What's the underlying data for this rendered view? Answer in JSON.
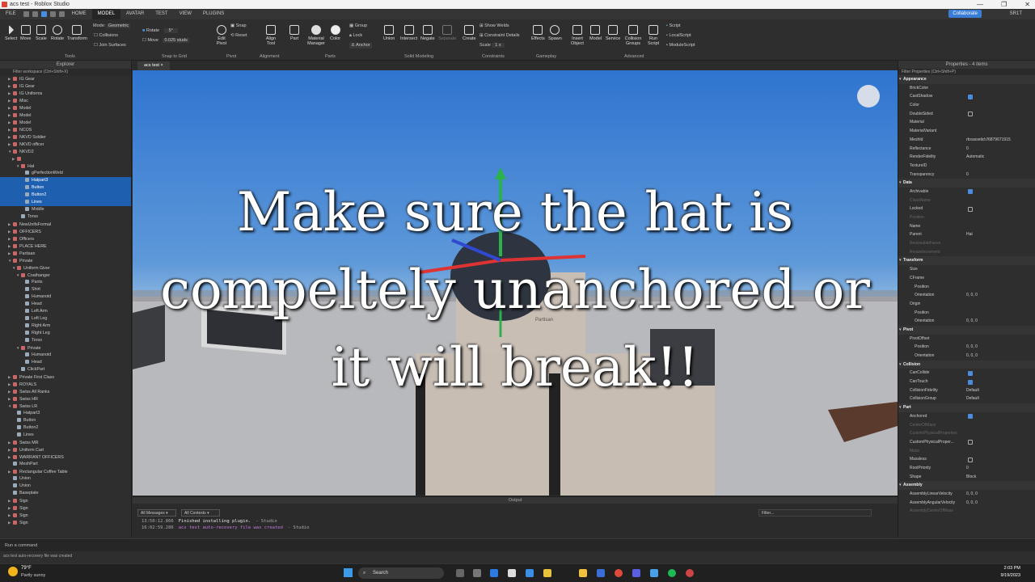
{
  "window": {
    "title": "acs test - Roblox Studio",
    "controls": [
      "—",
      "❐",
      "✕"
    ]
  },
  "menubar": {
    "file": "FILE",
    "tabs": [
      "HOME",
      "MODEL",
      "AVATAR",
      "TEST",
      "VIEW",
      "PLUGINS"
    ],
    "collaborate": "Collaborate",
    "user": "SR1T"
  },
  "ribbon": {
    "tools": [
      "Select",
      "Move",
      "Scale",
      "Rotate",
      "Transform"
    ],
    "mode_label": "Mode:",
    "mode_value": "Geometric",
    "collisions": "Collisions",
    "join_surfaces": "Join Surfaces",
    "rotate_label": "Rotate",
    "rotate_value": "5°",
    "move_label": "Move",
    "move_value": "0.025 studs",
    "edit_pivot": "Edit Pivot",
    "snap": "Snap",
    "reset": "Reset",
    "align_tool": "Align Tool",
    "part": "Part",
    "material_manager": "Material Manager",
    "color": "Color",
    "group": "Group",
    "lock": "Lock",
    "anchor": "Anchor",
    "union": "Union",
    "intersect": "Intersect",
    "negate": "Negate",
    "separate": "Separate",
    "create": "Create",
    "show_welds": "Show Welds",
    "constraint_details": "Constraint Details",
    "scale_label": "Scale",
    "scale_value": "1 x",
    "effects": "Effects",
    "spawn": "Spawn",
    "insert_object": "Insert Object",
    "model": "Model",
    "service": "Service",
    "collision_groups": "Collision Groups",
    "run_script": "Run Script",
    "script": "Script",
    "localscript": "LocalScript",
    "modulescript": "ModuleScript",
    "groups": [
      "Tools",
      "Snap to Grid",
      "Pivot",
      "Alignment",
      "Parts",
      "Solid Modeling",
      "Constraints",
      "Gameplay",
      "Advanced"
    ]
  },
  "explorer": {
    "title": "Explorer",
    "filter": "Filter workspace (Ctrl+Shift+X)",
    "rows": [
      {
        "t": "IG Gear",
        "d": 2
      },
      {
        "t": "IG Gear",
        "d": 2
      },
      {
        "t": "IG Uniforms",
        "d": 2
      },
      {
        "t": "Misc",
        "d": 2
      },
      {
        "t": "Model",
        "d": 2
      },
      {
        "t": "Model",
        "d": 2
      },
      {
        "t": "Model",
        "d": 2
      },
      {
        "t": "NCOS",
        "d": 2
      },
      {
        "t": "NKVD Soldier",
        "d": 2
      },
      {
        "t": "NKVD officer",
        "d": 2
      },
      {
        "t": "NKVD2",
        "d": 2,
        "o": true
      },
      {
        "t": "",
        "d": 3
      },
      {
        "t": "Hat",
        "d": 4,
        "o": true
      },
      {
        "t": "gPerfectionWeld",
        "d": 5,
        "p": true
      },
      {
        "t": "Hatpart3",
        "d": 5,
        "p": true,
        "s": true
      },
      {
        "t": "Button",
        "d": 5,
        "p": true,
        "s": true
      },
      {
        "t": "Button2",
        "d": 5,
        "p": true,
        "s": true
      },
      {
        "t": "Lines",
        "d": 5,
        "p": true,
        "s": true
      },
      {
        "t": "Middle",
        "d": 5,
        "p": true
      },
      {
        "t": "Torso",
        "d": 4,
        "p": true
      },
      {
        "t": "NewUnifsFormal",
        "d": 2
      },
      {
        "t": "OFFICERS",
        "d": 2
      },
      {
        "t": "Officers",
        "d": 2
      },
      {
        "t": "PLACE HERE",
        "d": 2
      },
      {
        "t": "Partisan",
        "d": 2
      },
      {
        "t": "Private",
        "d": 2,
        "o": true
      },
      {
        "t": "Uniform Giver",
        "d": 3,
        "o": true
      },
      {
        "t": "Coathanger",
        "d": 4,
        "o": true
      },
      {
        "t": "Pants",
        "d": 5,
        "p": true
      },
      {
        "t": "Shirt",
        "d": 5,
        "p": true
      },
      {
        "t": "Humanoid",
        "d": 5,
        "p": true
      },
      {
        "t": "Head",
        "d": 5,
        "p": true
      },
      {
        "t": "Left Arm",
        "d": 5,
        "p": true
      },
      {
        "t": "Left Leg",
        "d": 5,
        "p": true
      },
      {
        "t": "Right Arm",
        "d": 5,
        "p": true
      },
      {
        "t": "Right Leg",
        "d": 5,
        "p": true
      },
      {
        "t": "Torso",
        "d": 5,
        "p": true
      },
      {
        "t": "Private",
        "d": 4,
        "o": true
      },
      {
        "t": "Humanoid",
        "d": 5,
        "p": true
      },
      {
        "t": "Head",
        "d": 5,
        "p": true
      },
      {
        "t": "ClickPart",
        "d": 4,
        "p": true
      },
      {
        "t": "Private First Class",
        "d": 2
      },
      {
        "t": "ROYALS",
        "d": 2
      },
      {
        "t": "Swiss All Ranks",
        "d": 2
      },
      {
        "t": "Swiss HR",
        "d": 2
      },
      {
        "t": "Swiss LR",
        "d": 2,
        "o": true
      },
      {
        "t": "Hatpart3",
        "d": 3,
        "p": true
      },
      {
        "t": "Button",
        "d": 3,
        "p": true
      },
      {
        "t": "Button2",
        "d": 3,
        "p": true
      },
      {
        "t": "Lines",
        "d": 3,
        "p": true
      },
      {
        "t": "Swiss MR",
        "d": 2
      },
      {
        "t": "Uniform Cart",
        "d": 2
      },
      {
        "t": "WARRANT OFFICERS",
        "d": 2
      },
      {
        "t": "MeshPart",
        "d": 2,
        "p": true
      },
      {
        "t": "Rectangular Coffee Table",
        "d": 2
      },
      {
        "t": "Union",
        "d": 2,
        "p": true
      },
      {
        "t": "Union",
        "d": 2,
        "p": true
      },
      {
        "t": "Baseplate",
        "d": 2,
        "p": true
      },
      {
        "t": "Sign",
        "d": 2
      },
      {
        "t": "Sign",
        "d": 2
      },
      {
        "t": "Sign",
        "d": 2
      },
      {
        "t": "Sign",
        "d": 2
      }
    ]
  },
  "viewport": {
    "tab": "acs test",
    "caption": "Make sure the hat is compeltely unanchored or it will break!!",
    "nametag": "Partisan"
  },
  "output": {
    "title": "Output",
    "filter1": "All Messages",
    "filter2": "All Contexts",
    "search_placeholder": "Filter...",
    "lines": [
      {
        "time": "13:50:12.866",
        "msg": "Finished installing plugin.",
        "src": "- Studio"
      },
      {
        "time": "16:02:59.286",
        "msg": "acs test auto-recovery file was created",
        "src": "- Studio"
      }
    ]
  },
  "properties": {
    "title": "Properties - 4 items",
    "filter": "Filter Properties (Ctrl+Shift+P)",
    "rows": [
      {
        "c": "Appearance"
      },
      {
        "n": "BrickColor",
        "v": ""
      },
      {
        "n": "CastShadow",
        "k": true
      },
      {
        "n": "Color",
        "v": ""
      },
      {
        "n": "DoubleSided",
        "k": false
      },
      {
        "n": "Material",
        "v": ""
      },
      {
        "n": "MaterialVariant",
        "v": ""
      },
      {
        "n": "MeshId",
        "v": "rbxassetid://6879671915"
      },
      {
        "n": "Reflectance",
        "v": "0"
      },
      {
        "n": "RenderFidelity",
        "v": "Automatic"
      },
      {
        "n": "TextureID",
        "v": ""
      },
      {
        "n": "Transparency",
        "v": "0"
      },
      {
        "c": "Data"
      },
      {
        "n": "Archivable",
        "k": true
      },
      {
        "n": "ClassName",
        "v": "",
        "dim": true
      },
      {
        "n": "Locked",
        "k": false
      },
      {
        "n": "Position",
        "v": "",
        "dim": true
      },
      {
        "n": "Name",
        "v": ""
      },
      {
        "n": "Parent",
        "v": "Hat"
      },
      {
        "n": "ResizeableFaces",
        "v": "",
        "dim": true
      },
      {
        "n": "ResizeIncrement",
        "v": "",
        "dim": true
      },
      {
        "c": "Transform"
      },
      {
        "n": "Size",
        "v": ""
      },
      {
        "n": "CFrame",
        "v": ""
      },
      {
        "n": "Position",
        "v": "",
        "sub": true
      },
      {
        "n": "Orientation",
        "v": "0, 0, 0",
        "sub": true
      },
      {
        "n": "Origin",
        "v": ""
      },
      {
        "n": "Position",
        "v": "",
        "sub": true
      },
      {
        "n": "Orientation",
        "v": "0, 0, 0",
        "sub": true
      },
      {
        "c": "Pivot"
      },
      {
        "n": "PivotOffset",
        "v": ""
      },
      {
        "n": "Position",
        "v": "0, 0, 0",
        "sub": true
      },
      {
        "n": "Orientation",
        "v": "0, 0, 0",
        "sub": true
      },
      {
        "c": "Collision"
      },
      {
        "n": "CanCollide",
        "k": true
      },
      {
        "n": "CanTouch",
        "k": true
      },
      {
        "n": "CollisionFidelity",
        "v": "Default"
      },
      {
        "n": "CollisionGroup",
        "v": "Default"
      },
      {
        "c": "Part"
      },
      {
        "n": "Anchored",
        "k": true
      },
      {
        "n": "CenterOfMass",
        "v": "",
        "dim": true
      },
      {
        "n": "CustomPhysicalProperties",
        "v": "",
        "dim": true
      },
      {
        "n": "CustomPhysicalProper...",
        "k": false
      },
      {
        "n": "Mass",
        "v": "",
        "dim": true
      },
      {
        "n": "Massless",
        "k": false
      },
      {
        "n": "RootPriority",
        "v": "0"
      },
      {
        "n": "Shape",
        "v": "Block"
      },
      {
        "c": "Assembly"
      },
      {
        "n": "AssemblyLinearVelocity",
        "v": "0, 0, 0"
      },
      {
        "n": "AssemblyAngularVelocity",
        "v": "0, 0, 0"
      },
      {
        "n": "AssemblyCenterOfMass",
        "v": "",
        "dim": true
      }
    ]
  },
  "command_bar": {
    "placeholder": "Run a command"
  },
  "status": {
    "text": "acs test auto-recovery file was created"
  },
  "taskbar": {
    "weather_temp": "79°F",
    "weather_desc": "Partly sunny",
    "search": "Search",
    "time": "2:03 PM",
    "date": "9/19/2023"
  }
}
